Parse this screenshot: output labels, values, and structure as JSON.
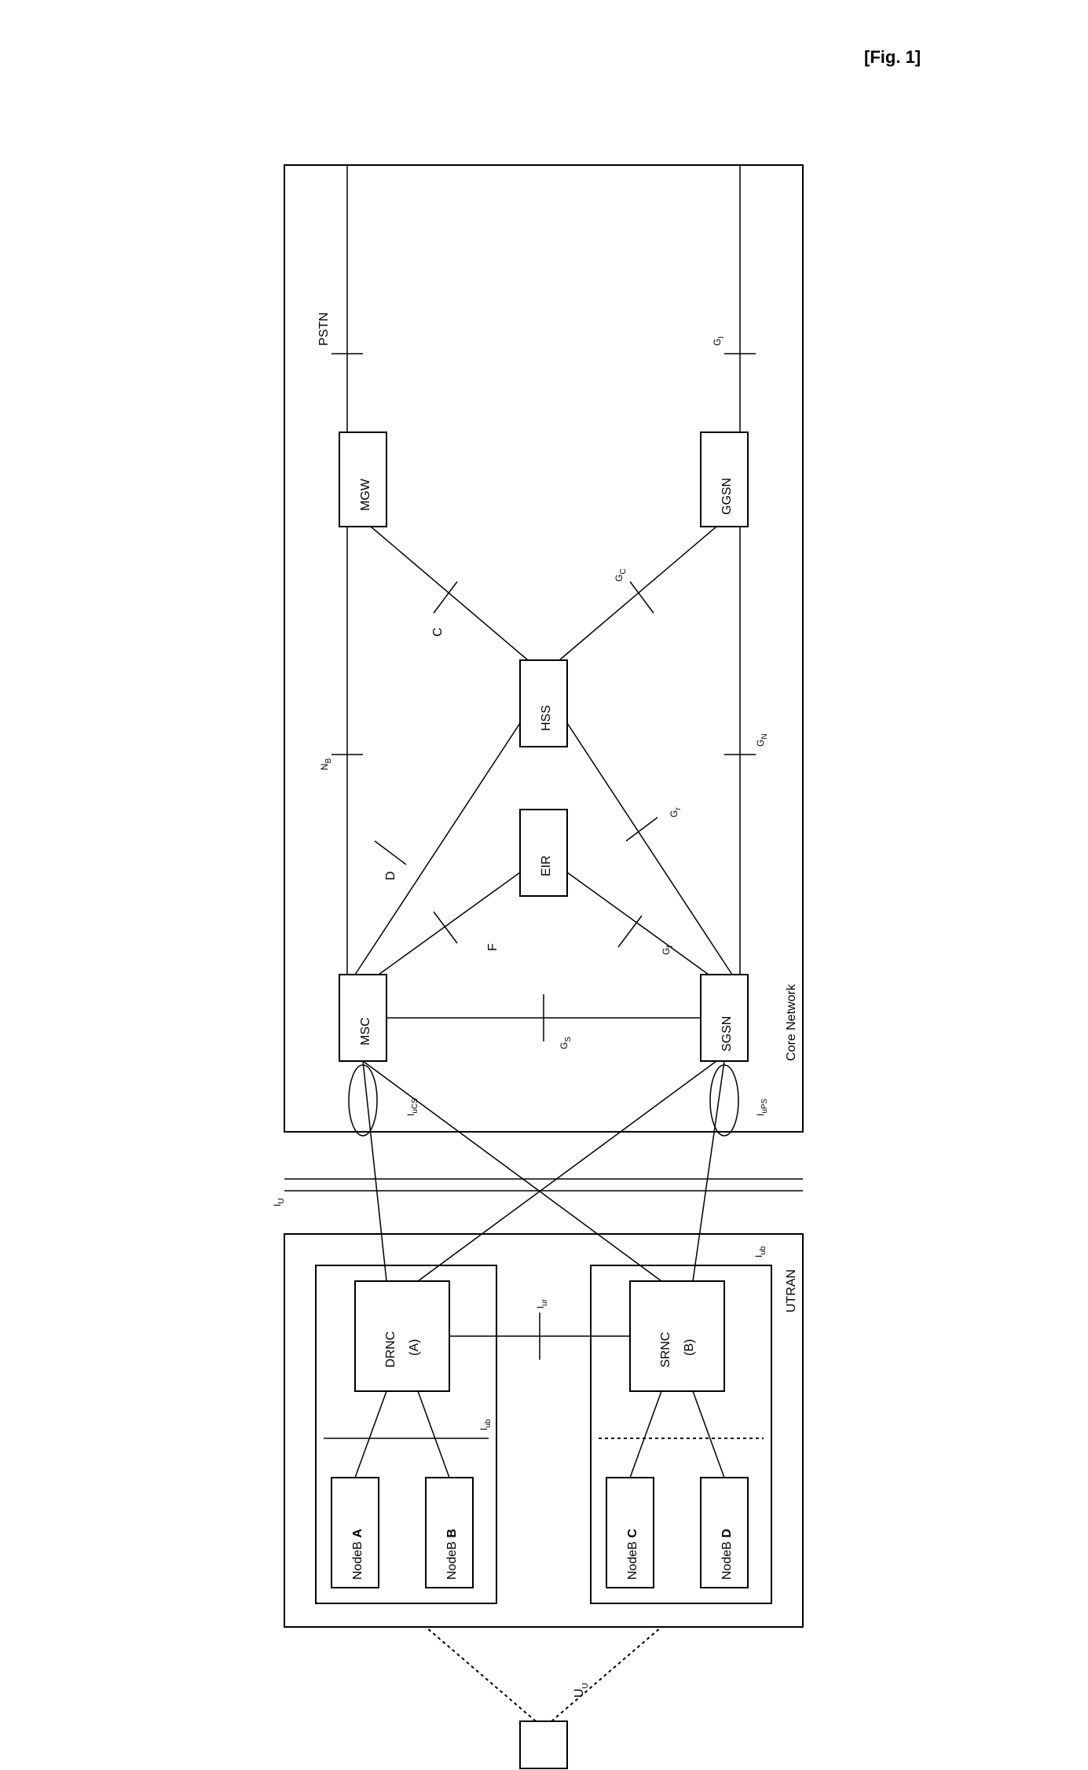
{
  "figure_label": "[Fig. 1]",
  "ue": {
    "label": ""
  },
  "uu": "U",
  "uu_sub": "U",
  "utran": {
    "label": "UTRAN",
    "rns_a": {
      "rnc": "DRNC",
      "rnc_sub": "(A)",
      "nodeb1": {
        "prefix": "NodeB ",
        "id": "A"
      },
      "nodeb2": {
        "prefix": "NodeB ",
        "id": "B"
      }
    },
    "rns_b": {
      "rnc": "SRNC",
      "rnc_sub": "(B)",
      "nodeb1": {
        "prefix": "NodeB ",
        "id": "C"
      },
      "nodeb2": {
        "prefix": "NodeB ",
        "id": "D"
      }
    },
    "iub_a": "I",
    "iub_a_sub": "ub",
    "iub_b": "I",
    "iub_b_sub": "ub",
    "iur": "I",
    "iur_sub": "ur"
  },
  "iu": "I",
  "iu_sub": "U",
  "iucs": "I",
  "iucs_sub": "uCS",
  "iups": "I",
  "iups_sub": "uPS",
  "core": {
    "label": "Core Network",
    "msc": "MSC",
    "sgsn": "SGSN",
    "eir": "EIR",
    "hss": "HSS",
    "mgw": "MGW",
    "ggsn": "GGSN",
    "gs": "G",
    "gs_sub": "S",
    "d": "D",
    "f": "F",
    "gf": "G",
    "gf_sub": "f",
    "gr": "G",
    "gr_sub": "r",
    "c": "C",
    "gc": "G",
    "gc_sub": "C",
    "nb": "N",
    "nb_sub": "B",
    "gn": "G",
    "gn_sub": "N",
    "pstn": "PSTN",
    "gi": "G",
    "gi_sub": "I"
  }
}
